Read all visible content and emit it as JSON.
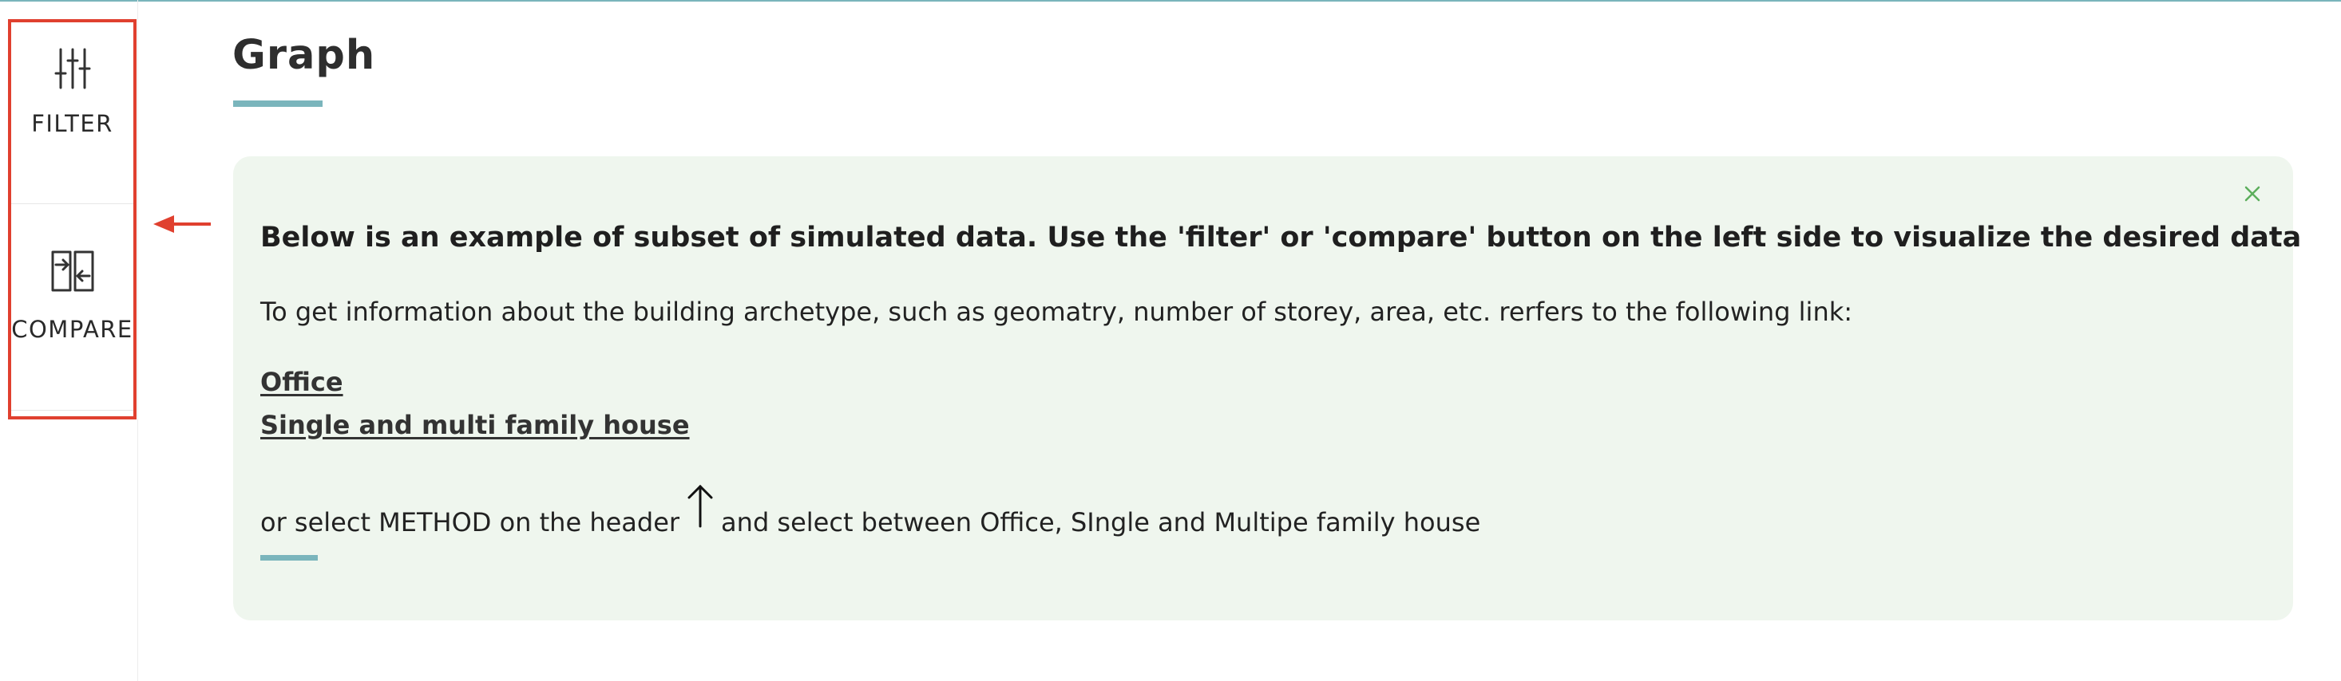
{
  "sidebar": {
    "filter_label": "FILTER",
    "compare_label": "COMPARE"
  },
  "page": {
    "title": "Graph"
  },
  "info_card": {
    "heading": "Below is an example of subset of simulated data. Use the 'filter' or 'compare' button on the left side to visualize the desired data",
    "description": "To get information about the building archetype, such as geomatry, number of storey, area, etc. rerfers to the following link:",
    "links": [
      {
        "label": "Office"
      },
      {
        "label": "Single and multi family house"
      }
    ],
    "method_prefix": "or select METHOD on the header",
    "method_suffix": "and select between Office, SIngle and Multipe family house",
    "close_icon": "close-icon"
  },
  "colors": {
    "accent": "#7ab5bc",
    "highlight": "#e0402f",
    "card_background": "#eff6ee",
    "close_icon": "#5cae5c"
  }
}
